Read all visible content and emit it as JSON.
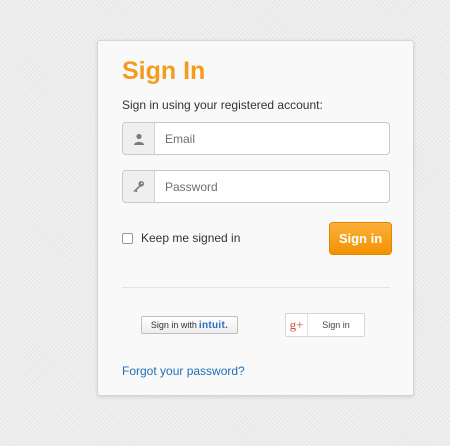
{
  "signin": {
    "title": "Sign In",
    "subtitle": "Sign in using your registered account:",
    "email_placeholder": "Email",
    "password_placeholder": "Password",
    "remember_label": "Keep me signed in",
    "remember_checked": false,
    "submit_label": "Sign in",
    "forgot_link": "Forgot your password?"
  },
  "social": {
    "intuit_prefix": "Sign in with",
    "intuit_brand": "intuit.",
    "google_icon_label": "g+",
    "google_label": "Sign in"
  },
  "icons": {
    "email": "user-icon",
    "password": "key-icon"
  },
  "colors": {
    "accent": "#f39c1f",
    "button": "#f7a21a",
    "link": "#1f6fb5",
    "intuit_brand": "#2a6fc2",
    "google_red": "#dd4b39"
  }
}
